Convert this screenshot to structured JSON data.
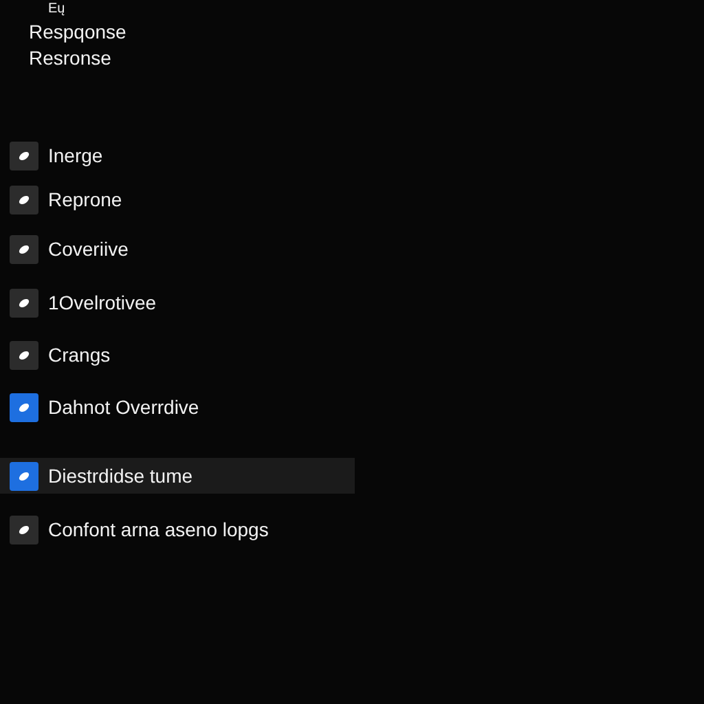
{
  "header": {
    "mark": "Eų",
    "lines": [
      "Respqonse",
      "Resronse"
    ]
  },
  "options": [
    {
      "label": "Inerge",
      "active": false,
      "selected": false
    },
    {
      "label": "Reprone",
      "active": false,
      "selected": false
    },
    {
      "label": "Coveriive",
      "active": false,
      "selected": false
    },
    {
      "label": "1Ovelrotivee",
      "active": false,
      "selected": false
    },
    {
      "label": "Crangs",
      "active": false,
      "selected": false
    },
    {
      "label": "Dahnot Overrdive",
      "active": true,
      "selected": false
    },
    {
      "label": "Diestrdidse tume",
      "active": true,
      "selected": true
    },
    {
      "label": "Confont arna aseno lopgs",
      "active": false,
      "selected": false
    }
  ]
}
